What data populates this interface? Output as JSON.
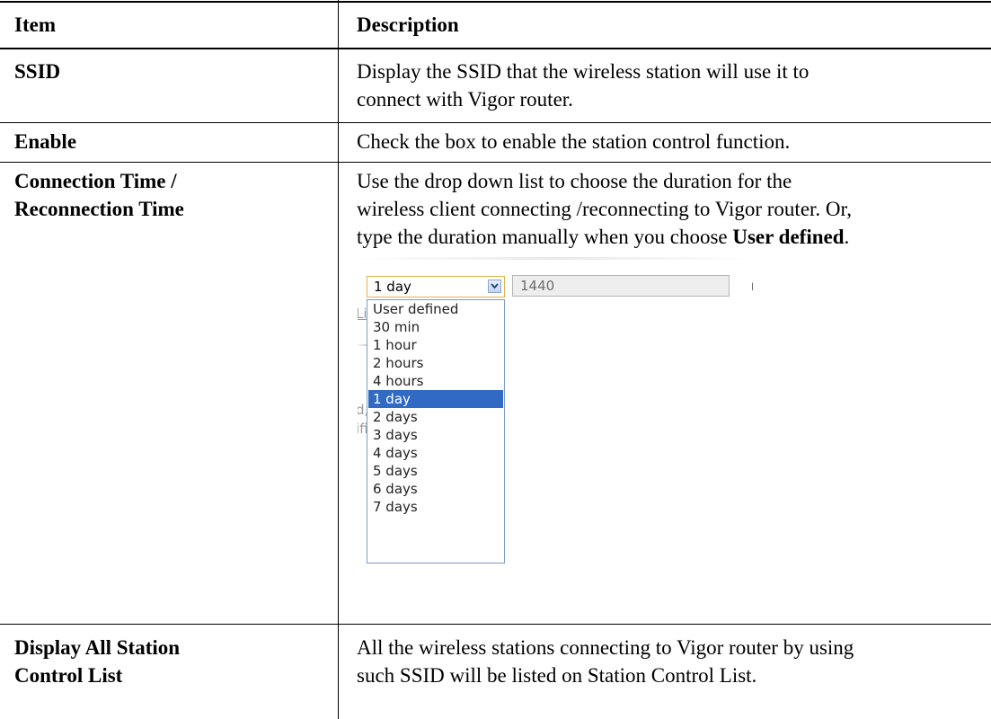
{
  "table": {
    "header": {
      "item": "Item",
      "description": "Description"
    },
    "rows": [
      {
        "item": "SSID",
        "description_lines": [
          "Display the SSID that the wireless station will use it to",
          "connect with Vigor router."
        ]
      },
      {
        "item": "Enable",
        "description_lines": [
          "Check the box to enable the station control function."
        ]
      },
      {
        "item_lines": [
          "Connection Time /",
          "Reconnection Time"
        ],
        "description_lines": [
          "Use the drop down list to choose the duration for the",
          "wireless client connecting /reconnecting to Vigor router. Or,"
        ],
        "description_last_prefix": "type the duration manually when you choose ",
        "description_last_bold": "User defined",
        "description_last_suffix": "."
      },
      {
        "item_lines": [
          "Display All Station",
          "Control List"
        ],
        "description_lines": [
          "All the wireless stations connecting to Vigor router by using",
          "such SSID will be listed on Station Control List."
        ]
      }
    ]
  },
  "screenshot": {
    "select_value": "1 day",
    "input_value": "1440",
    "unit_label": "min",
    "options": [
      "User defined",
      "30 min",
      "1 hour",
      "2 hours",
      "4 hours",
      "1 day",
      "2 days",
      "3 days",
      "4 days",
      "5 days",
      "6 days",
      "7 days"
    ],
    "selected_option": "1 day",
    "ghost_fragments": [
      "Li",
      "d,",
      "ifi"
    ],
    "colors": {
      "selection": "#316ac5",
      "select_border": "#e0b34a",
      "listbox_border": "#7a9cc8"
    }
  }
}
